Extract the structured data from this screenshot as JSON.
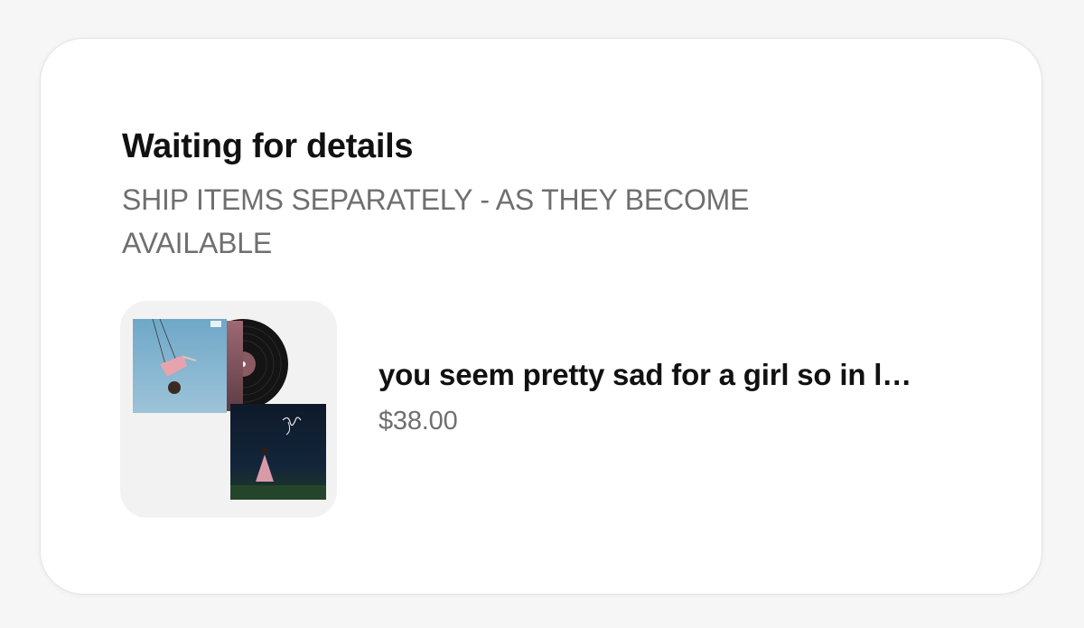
{
  "order": {
    "status_title": "Waiting for details",
    "shipping_note": "SHIP ITEMS SEPARATELY - AS THEY BECOME AVAILABLE"
  },
  "item": {
    "title": "you seem pretty sad for a girl so in l…",
    "price": "$38.00",
    "image_semantic": "album-bundle-vinyl-and-signed-print"
  },
  "colors": {
    "card_background": "#ffffff",
    "page_background": "#f6f6f6",
    "text_primary": "#111111",
    "text_secondary": "#6f6f6f",
    "thumb_background": "#f2f2f2"
  }
}
